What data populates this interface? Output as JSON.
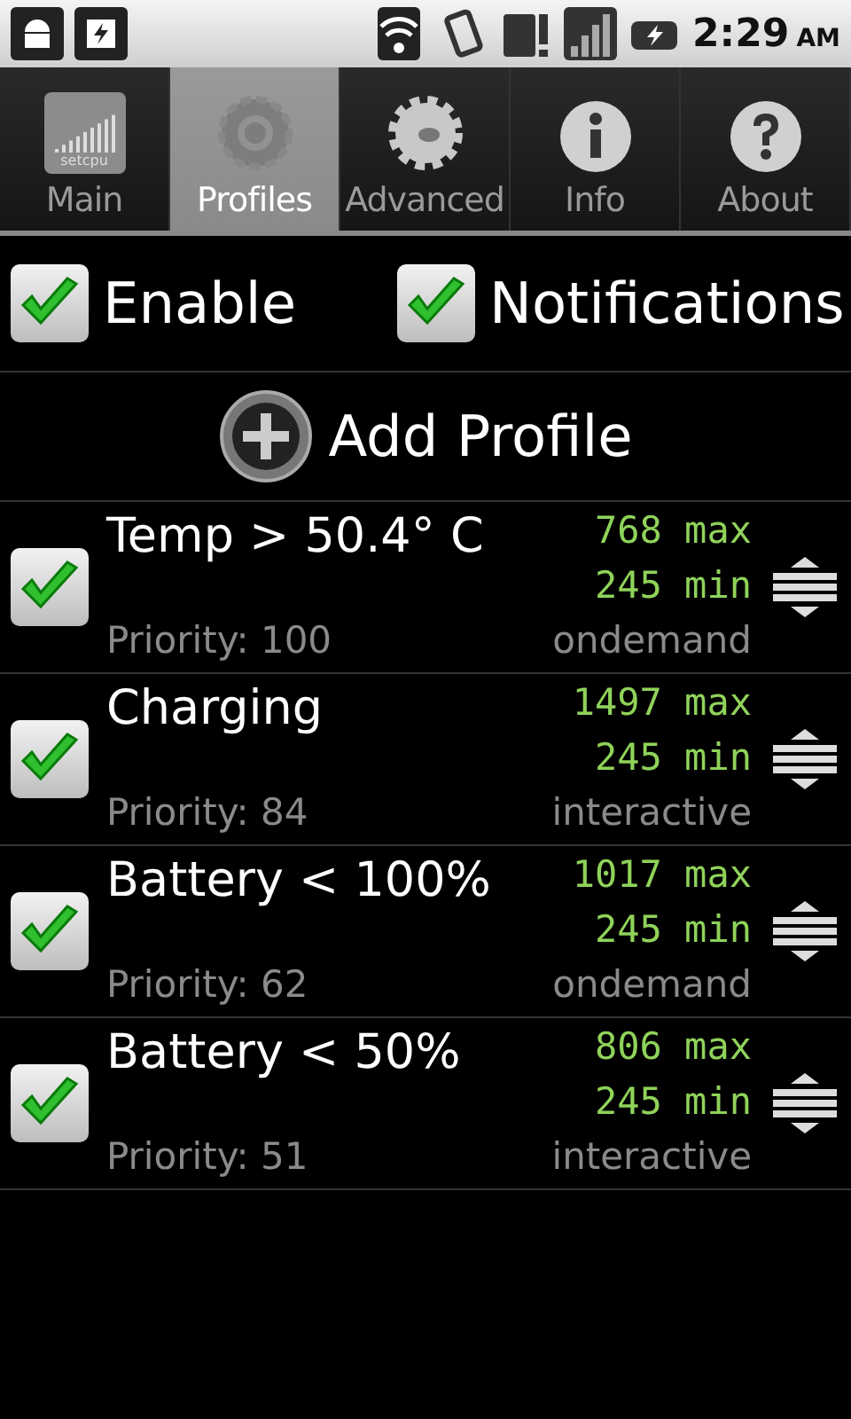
{
  "status_bar": {
    "time": "2:29",
    "meridiem": "AM"
  },
  "tabs": [
    {
      "label": "Main",
      "selected": false,
      "icon_text": "setcpu"
    },
    {
      "label": "Profiles",
      "selected": true
    },
    {
      "label": "Advanced",
      "selected": false
    },
    {
      "label": "Info",
      "selected": false
    },
    {
      "label": "About",
      "selected": false
    }
  ],
  "toggles": [
    {
      "label": "Enable",
      "checked": true
    },
    {
      "label": "Notifications",
      "checked": true
    }
  ],
  "add_button": {
    "label": "Add Profile"
  },
  "profiles": [
    {
      "name": "Temp > 50.4° C",
      "checked": true,
      "max": "768 max",
      "min": "245 min",
      "priority": "Priority: 100",
      "governor": "ondemand"
    },
    {
      "name": "Charging",
      "checked": true,
      "max": "1497 max",
      "min": "245 min",
      "priority": "Priority: 84",
      "governor": "interactive"
    },
    {
      "name": "Battery < 100%",
      "checked": true,
      "max": "1017 max",
      "min": "245 min",
      "priority": "Priority: 62",
      "governor": "ondemand"
    },
    {
      "name": "Battery < 50%",
      "checked": true,
      "max": "806 max",
      "min": "245 min",
      "priority": "Priority: 51",
      "governor": "interactive"
    }
  ]
}
